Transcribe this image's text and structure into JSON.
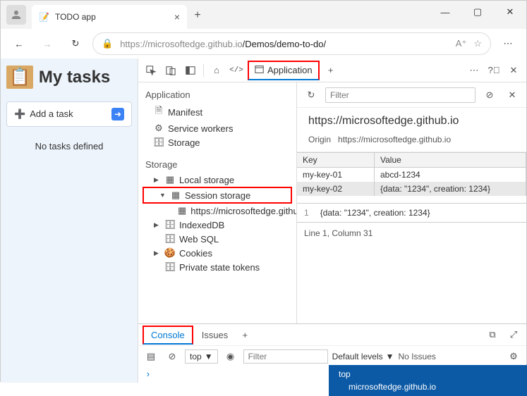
{
  "browser": {
    "tab_title": "TODO app",
    "url_host": "https://microsoftedge.github.io",
    "url_path": "/Demos/demo-to-do/"
  },
  "page": {
    "heading": "My tasks",
    "add_task": "Add a task",
    "no_tasks": "No tasks defined"
  },
  "devtools": {
    "tab_application": "Application",
    "side": {
      "h_application": "Application",
      "manifest": "Manifest",
      "service_workers": "Service workers",
      "storage_app": "Storage",
      "h_storage": "Storage",
      "local_storage": "Local storage",
      "session_storage": "Session storage",
      "origin_item": "https://microsoftedge.github.io",
      "indexeddb": "IndexedDB",
      "websql": "Web SQL",
      "cookies": "Cookies",
      "private_tokens": "Private state tokens"
    },
    "content": {
      "filter_placeholder": "Filter",
      "origin_title": "https://microsoftedge.github.io",
      "origin_label": "Origin",
      "origin_value": "https://microsoftedge.github.io",
      "col_key": "Key",
      "col_value": "Value",
      "rows": [
        {
          "k": "my-key-01",
          "v": "abcd-1234"
        },
        {
          "k": "my-key-02",
          "v": "{data: \"1234\", creation: 1234}"
        }
      ],
      "preview_line": "1",
      "preview_text": "{data: \"1234\", creation: 1234}",
      "status": "Line 1, Column 31"
    },
    "drawer": {
      "tab_console": "Console",
      "tab_issues": "Issues",
      "context_label": "top",
      "filter_placeholder": "Filter",
      "levels": "Default levels",
      "no_issues": "No Issues",
      "menu_top": "top",
      "menu_origin": "microsoftedge.github.io"
    }
  }
}
